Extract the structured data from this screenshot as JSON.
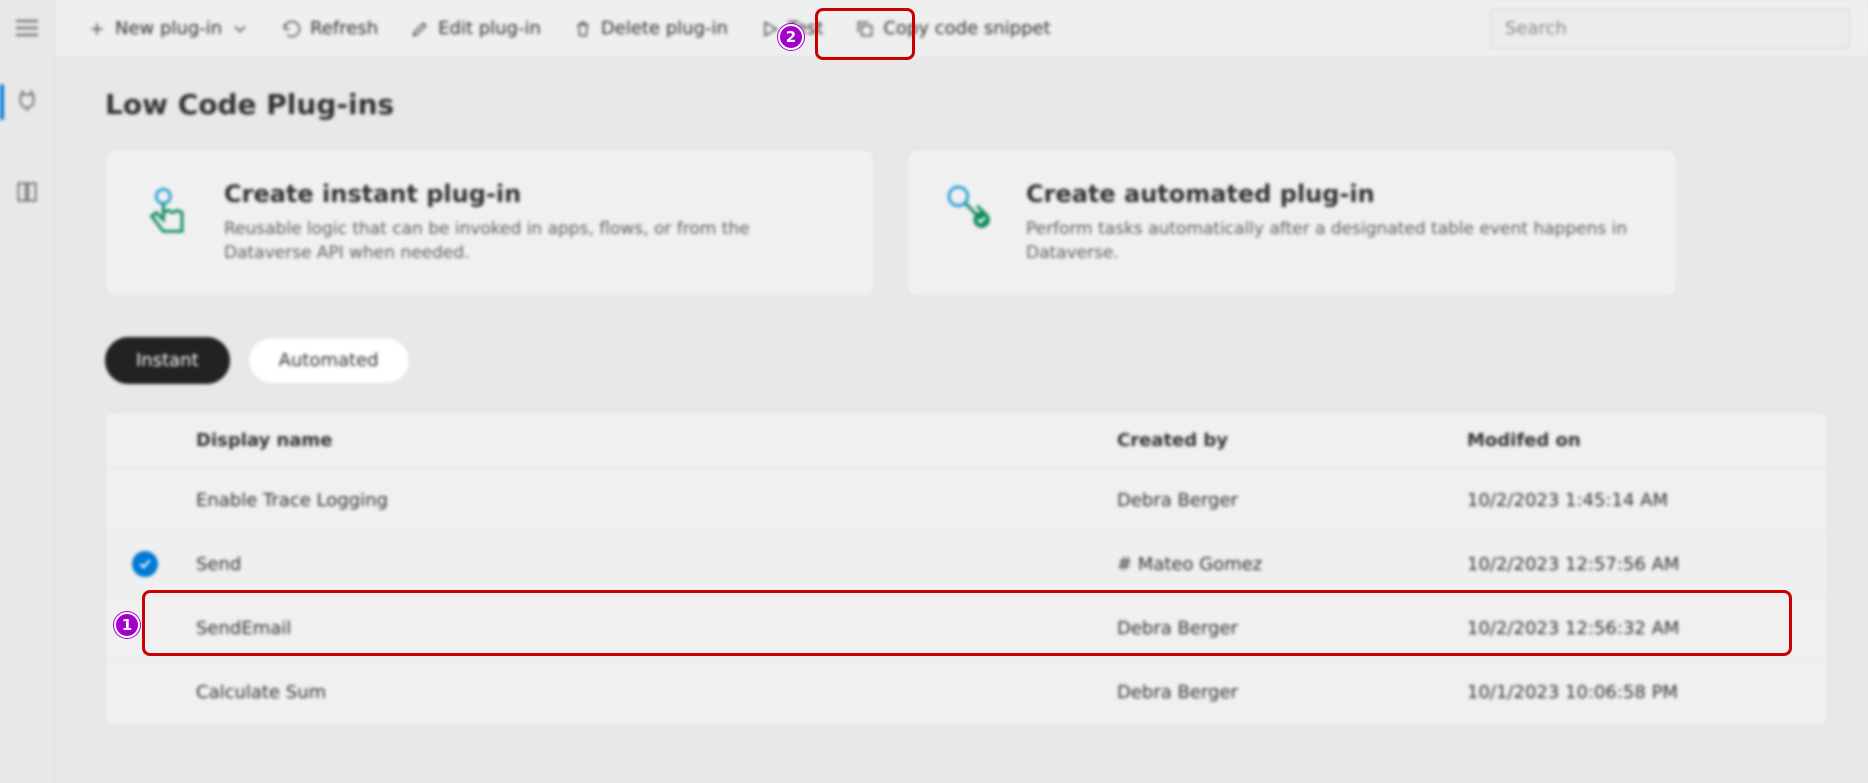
{
  "toolbar": {
    "new_plugin": "New plug-in",
    "refresh": "Refresh",
    "edit": "Edit plug-in",
    "delete": "Delete plug-in",
    "test": "Test",
    "copy": "Copy code snippet",
    "search_placeholder": "Search"
  },
  "page": {
    "title": "Low Code Plug-ins"
  },
  "cards": {
    "instant": {
      "title": "Create instant plug-in",
      "desc": "Reusable logic that can be invoked in apps, flows, or from the Dataverse API when needed."
    },
    "automated": {
      "title": "Create automated plug-in",
      "desc": "Perform tasks automatically after a designated table event happens in Dataverse."
    }
  },
  "tabs": {
    "instant": "Instant",
    "automated": "Automated"
  },
  "table": {
    "headers": {
      "display_name": "Display name",
      "created_by": "Created by",
      "modified_on": "Modifed on"
    },
    "rows": [
      {
        "selected": false,
        "name": "Enable Trace Logging",
        "created_by": "Debra Berger",
        "modified_on": "10/2/2023 1:45:14 AM"
      },
      {
        "selected": true,
        "name": "Send",
        "created_by": "# Mateo Gomez",
        "modified_on": "10/2/2023 12:57:56 AM"
      },
      {
        "selected": false,
        "name": "SendEmail",
        "created_by": "Debra Berger",
        "modified_on": "10/2/2023 12:56:32 AM"
      },
      {
        "selected": false,
        "name": "Calculate Sum",
        "created_by": "Debra Berger",
        "modified_on": "10/1/2023 10:06:58 PM"
      }
    ]
  },
  "callouts": {
    "one": "1",
    "two": "2"
  }
}
